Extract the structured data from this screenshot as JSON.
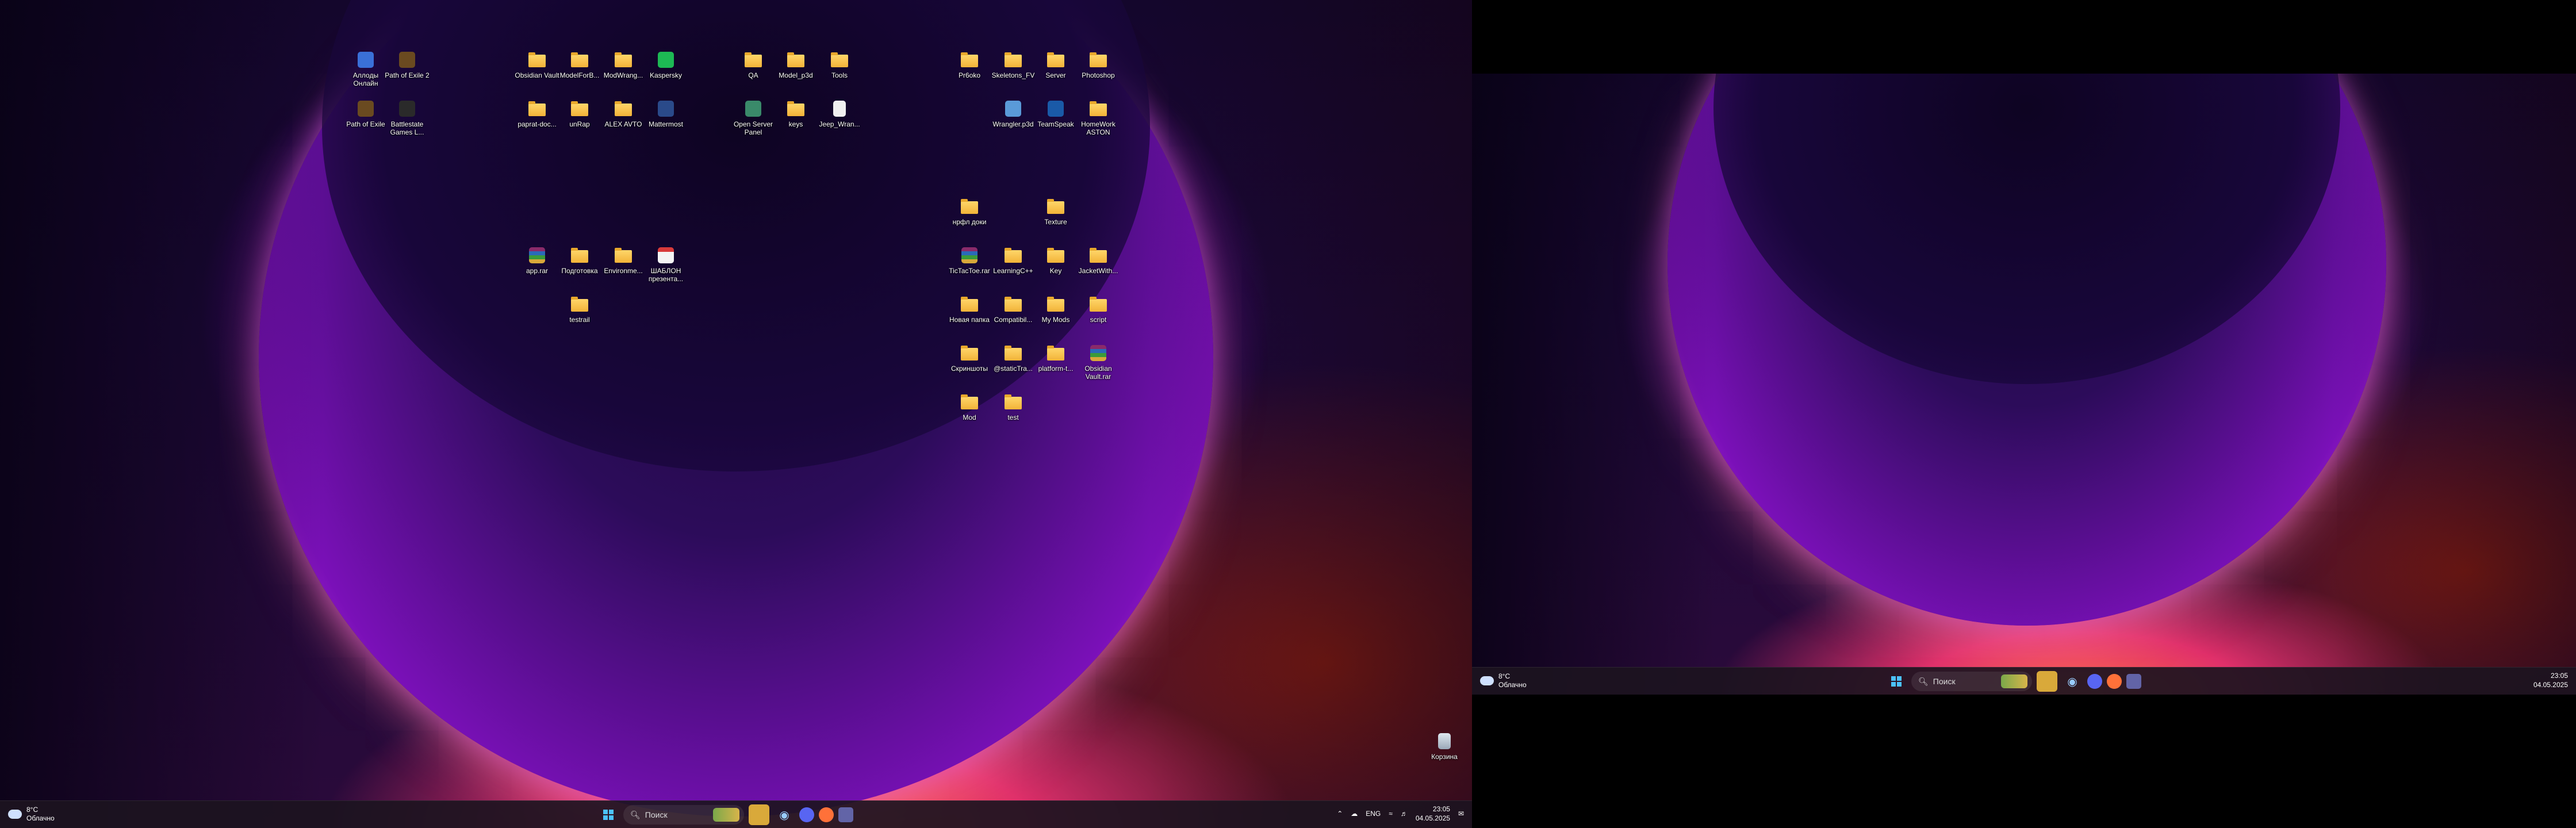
{
  "desktop": {
    "icons": [
      {
        "label": "Аллоды Онлайн",
        "kind": "app",
        "color": "#3a70d8"
      },
      {
        "label": "Path of Exile 2",
        "kind": "app",
        "color": "#6a4a20"
      },
      {
        "label": "Path of Exile",
        "kind": "app",
        "color": "#6a4a20"
      },
      {
        "label": "Battlestate Games L...",
        "kind": "app",
        "color": "#2a2a2a"
      },
      {
        "label": "Obsidian Vault",
        "kind": "folder"
      },
      {
        "label": "ModelForB...",
        "kind": "folder"
      },
      {
        "label": "ModWrang...",
        "kind": "folder"
      },
      {
        "label": "Kaspersky",
        "kind": "app",
        "color": "#1db954"
      },
      {
        "label": "рарrat-doc...",
        "kind": "folder"
      },
      {
        "label": "unRap",
        "kind": "folder"
      },
      {
        "label": "ALEX AVTO",
        "kind": "folder"
      },
      {
        "label": "Mattermost",
        "kind": "app",
        "color": "#2a4a8a"
      },
      {
        "label": "QA",
        "kind": "folder"
      },
      {
        "label": "Model_p3d",
        "kind": "folder"
      },
      {
        "label": "Tools",
        "kind": "folder"
      },
      {
        "label": "Open Server Panel",
        "kind": "app",
        "color": "#3a8a6a"
      },
      {
        "label": "keys",
        "kind": "folder"
      },
      {
        "label": "Jeep_Wran...",
        "kind": "file"
      },
      {
        "label": "Pr6oko",
        "kind": "folder"
      },
      {
        "label": "Skeletons_FV",
        "kind": "folder"
      },
      {
        "label": "Server",
        "kind": "folder"
      },
      {
        "label": "Photoshop",
        "kind": "folder"
      },
      {
        "label": "Wrangler.p3d",
        "kind": "app",
        "color": "#5a9ad8"
      },
      {
        "label": "TeamSpeak",
        "kind": "app",
        "color": "#1a5aa8"
      },
      {
        "label": "HomeWork ASTON",
        "kind": "folder"
      },
      {
        "label": "нрфл доки",
        "kind": "folder"
      },
      {
        "label": "Texture",
        "kind": "folder"
      },
      {
        "label": "арр.rar",
        "kind": "archive"
      },
      {
        "label": "Подготовка",
        "kind": "folder"
      },
      {
        "label": "Environme...",
        "kind": "folder"
      },
      {
        "label": "ШАБЛОН презента...",
        "kind": "pdf"
      },
      {
        "label": "testrail",
        "kind": "folder"
      },
      {
        "label": "TicTacToe.rar",
        "kind": "archive"
      },
      {
        "label": "LearningC++",
        "kind": "folder"
      },
      {
        "label": "Key",
        "kind": "folder"
      },
      {
        "label": "JacketWith...",
        "kind": "folder"
      },
      {
        "label": "Новая папка",
        "kind": "folder"
      },
      {
        "label": "Compatibil...",
        "kind": "folder"
      },
      {
        "label": "My Mods",
        "kind": "folder"
      },
      {
        "label": "script",
        "kind": "folder"
      },
      {
        "label": "Скриншоты",
        "kind": "folder"
      },
      {
        "label": "@staticTra...",
        "kind": "folder"
      },
      {
        "label": "platform-t...",
        "kind": "folder"
      },
      {
        "label": "Obsidian Vault.rar",
        "kind": "archive"
      },
      {
        "label": "Mod",
        "kind": "folder"
      },
      {
        "label": "test",
        "kind": "folder"
      },
      {
        "label": "Корзина",
        "kind": "recycle"
      }
    ]
  },
  "taskbar1": {
    "weather_temp": "8°C",
    "weather_desc": "Облачно",
    "search_placeholder": "Поиск",
    "lang": "ENG",
    "time": "23:05",
    "date": "04.05.2025"
  },
  "taskbar2": {
    "weather_temp": "8°C",
    "weather_desc": "Облачно",
    "search_placeholder": "Поиск",
    "time": "23:05",
    "date": "04.05.2025"
  }
}
